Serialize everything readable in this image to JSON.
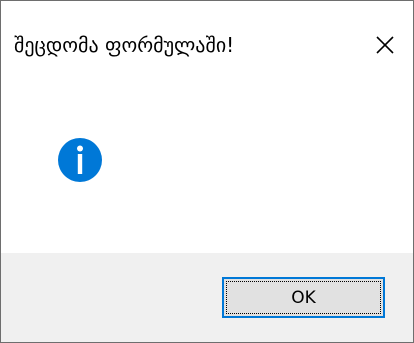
{
  "dialog": {
    "title": "შეცდომა ფორმულაში!",
    "close_icon": "close-icon",
    "message_icon": "info-icon",
    "ok_label": "OK"
  },
  "colors": {
    "accent": "#0078d7",
    "footer_bg": "#f0f0f0",
    "button_bg": "#e1e1e1"
  }
}
